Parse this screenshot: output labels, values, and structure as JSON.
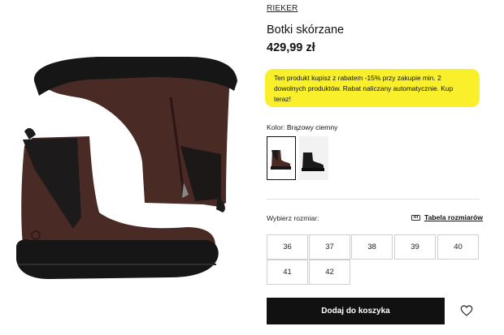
{
  "product": {
    "brand": "RIEKER",
    "title": "Botki skórzane",
    "price": "429,99 zł"
  },
  "promo": {
    "text": "Ten produkt kupisz z rabatem -15% przy zakupie min. 2 dowolnych produktów. Rabat naliczany automatycznie. Kup teraz!",
    "background": "#f9f02b"
  },
  "color": {
    "label": "Kolor:",
    "value": "Brązowy ciemny",
    "swatches": [
      {
        "name": "Brązowy ciemny",
        "selected": true
      },
      {
        "name": "Czarny",
        "selected": false
      }
    ]
  },
  "size": {
    "label": "Wybierz rozmiar:",
    "guide_label": "Tabela rozmiarów",
    "options": [
      "36",
      "37",
      "38",
      "39",
      "40",
      "41",
      "42"
    ]
  },
  "cart": {
    "add_label": "Dodaj do koszyka"
  },
  "icons": {
    "size_guide": "ruler-icon",
    "wishlist": "heart-icon"
  },
  "colors": {
    "boot_brown": "#4a2a25",
    "sole_black": "#161616",
    "button_black": "#111111"
  }
}
